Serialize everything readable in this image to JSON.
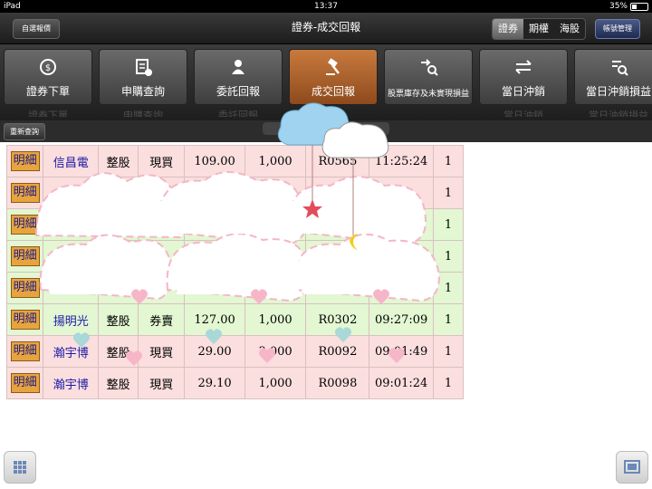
{
  "status_bar": {
    "device": "iPad",
    "time": "13:37",
    "battery": "35%"
  },
  "nav": {
    "left_button": "自選報價",
    "title": "證券-成交回報",
    "segments": [
      "證券",
      "期權",
      "海股"
    ],
    "right_button": "帳號管理"
  },
  "toolbar": {
    "items": [
      {
        "label": "證券下單",
        "icon": "clock-dollar-icon"
      },
      {
        "label": "申購查詢",
        "icon": "receipt-icon"
      },
      {
        "label": "委託回報",
        "icon": "person-icon"
      },
      {
        "label": "成交回報",
        "icon": "gavel-icon",
        "active": true
      },
      {
        "label": "股票庫存及未實現損益",
        "icon": "exchange-search-icon"
      },
      {
        "label": "當日沖銷",
        "icon": "swap-arrows-icon"
      },
      {
        "label": "當日沖銷損益",
        "icon": "document-search-icon"
      }
    ]
  },
  "subbar": {
    "refresh_button": "重新查詢"
  },
  "table": {
    "detail_label": "明細",
    "rows": [
      {
        "name": "信昌電",
        "type": "整股",
        "side": "現買",
        "price": "109.00",
        "qty": "1,000",
        "order": "R0565",
        "time": "11:25:24",
        "count": "1",
        "bg": "pink"
      },
      {
        "name": "",
        "type": "",
        "side": "",
        "price": "",
        "qty": "",
        "order": "",
        "time": "",
        "count": "1",
        "bg": "pink"
      },
      {
        "name": "",
        "type": "",
        "side": "",
        "price": "",
        "qty": "",
        "order": "",
        "time": "",
        "count": "1",
        "bg": "green"
      },
      {
        "name": "",
        "type": "",
        "side": "",
        "price": "",
        "qty": "",
        "order": "",
        "time": "",
        "count": "1",
        "bg": "green"
      },
      {
        "name": "",
        "type": "",
        "side": "",
        "price": "",
        "qty": "",
        "order": "",
        "time": "",
        "count": "1",
        "bg": "green"
      },
      {
        "name": "揚明光",
        "type": "整股",
        "side": "券賣",
        "price": "127.00",
        "qty": "1,000",
        "order": "R0302",
        "time": "09:27:09",
        "count": "1",
        "bg": "green"
      },
      {
        "name": "瀚宇博",
        "type": "整股",
        "side": "現買",
        "price": "29.00",
        "qty": "3,000",
        "order": "R0092",
        "time": "09:01:49",
        "count": "1",
        "bg": "pink"
      },
      {
        "name": "瀚宇博",
        "type": "整股",
        "side": "現買",
        "price": "29.10",
        "qty": "1,000",
        "order": "R0098",
        "time": "09:01:24",
        "count": "1",
        "bg": "pink"
      }
    ]
  },
  "colors": {
    "accent": "#c87a3e",
    "row_pink": "#fbdede",
    "row_green": "#e2f7d2",
    "name_blue": "#1a1aa8"
  }
}
